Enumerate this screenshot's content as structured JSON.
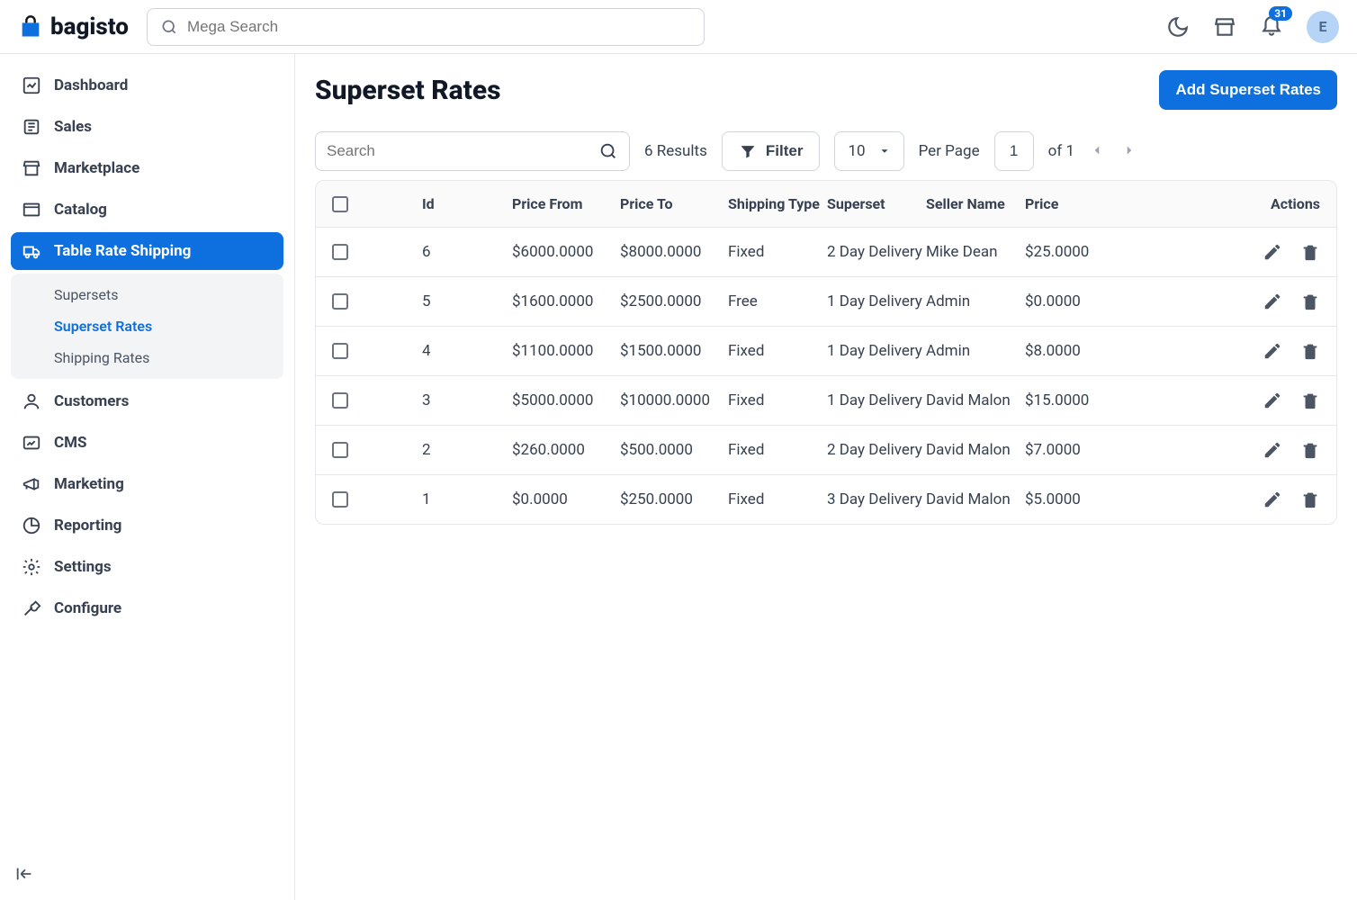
{
  "brand": "bagisto",
  "search": {
    "placeholder": "Mega Search"
  },
  "notifications": {
    "count": "31"
  },
  "avatar": {
    "initial": "E"
  },
  "sidebar": {
    "items": [
      {
        "label": "Dashboard"
      },
      {
        "label": "Sales"
      },
      {
        "label": "Marketplace"
      },
      {
        "label": "Catalog"
      },
      {
        "label": "Table Rate Shipping"
      },
      {
        "label": "Customers"
      },
      {
        "label": "CMS"
      },
      {
        "label": "Marketing"
      },
      {
        "label": "Reporting"
      },
      {
        "label": "Settings"
      },
      {
        "label": "Configure"
      }
    ],
    "sub": [
      {
        "label": "Supersets"
      },
      {
        "label": "Superset Rates"
      },
      {
        "label": "Shipping Rates"
      }
    ]
  },
  "page": {
    "title": "Superset Rates",
    "add_button": "Add Superset Rates"
  },
  "toolbar": {
    "search_placeholder": "Search",
    "results": "6 Results",
    "filter": "Filter",
    "perpage_value": "10",
    "perpage_label": "Per Page",
    "page_current": "1",
    "page_of": "of 1"
  },
  "table": {
    "headers": {
      "id": "Id",
      "price_from": "Price From",
      "price_to": "Price To",
      "shipping_type": "Shipping Type",
      "superset": "Superset",
      "seller_name": "Seller Name",
      "price": "Price",
      "actions": "Actions"
    },
    "rows": [
      {
        "id": "6",
        "price_from": "$6000.0000",
        "price_to": "$8000.0000",
        "shipping_type": "Fixed",
        "superset": "2 Day Delivery",
        "seller_name": "Mike Dean",
        "price": "$25.0000"
      },
      {
        "id": "5",
        "price_from": "$1600.0000",
        "price_to": "$2500.0000",
        "shipping_type": "Free",
        "superset": "1 Day Delivery",
        "seller_name": "Admin",
        "price": "$0.0000"
      },
      {
        "id": "4",
        "price_from": "$1100.0000",
        "price_to": "$1500.0000",
        "shipping_type": "Fixed",
        "superset": "1 Day Delivery",
        "seller_name": "Admin",
        "price": "$8.0000"
      },
      {
        "id": "3",
        "price_from": "$5000.0000",
        "price_to": "$10000.0000",
        "shipping_type": "Fixed",
        "superset": "1 Day Delivery",
        "seller_name": "David Malon",
        "price": "$15.0000"
      },
      {
        "id": "2",
        "price_from": "$260.0000",
        "price_to": "$500.0000",
        "shipping_type": "Fixed",
        "superset": "2 Day Delivery",
        "seller_name": "David Malon",
        "price": "$7.0000"
      },
      {
        "id": "1",
        "price_from": "$0.0000",
        "price_to": "$250.0000",
        "shipping_type": "Fixed",
        "superset": "3 Day Delivery",
        "seller_name": "David Malon",
        "price": "$5.0000"
      }
    ]
  }
}
